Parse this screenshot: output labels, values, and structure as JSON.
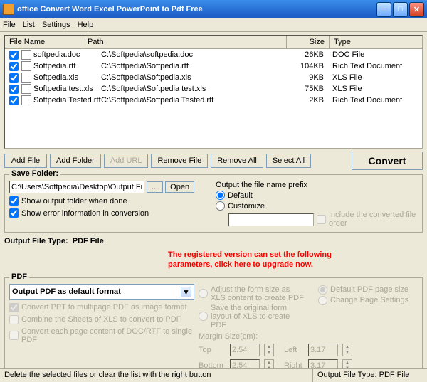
{
  "window": {
    "title": "office Convert Word Excel PowerPoint to Pdf Free"
  },
  "menu": [
    "File",
    "List",
    "Settings",
    "Help"
  ],
  "columns": {
    "name": "File Name",
    "path": "Path",
    "size": "Size",
    "type": "Type"
  },
  "files": [
    {
      "name": "softpedia.doc",
      "path": "C:\\Softpedia\\softpedia.doc",
      "size": "26KB",
      "type": "DOC File"
    },
    {
      "name": "Softpedia.rtf",
      "path": "C:\\Softpedia\\Softpedia.rtf",
      "size": "104KB",
      "type": "Rich Text Document"
    },
    {
      "name": "Softpedia.xls",
      "path": "C:\\Softpedia\\Softpedia.xls",
      "size": "9KB",
      "type": "XLS File"
    },
    {
      "name": "Softpedia test.xls",
      "path": "C:\\Softpedia\\Softpedia test.xls",
      "size": "75KB",
      "type": "XLS File"
    },
    {
      "name": "Softpedia Tested.rtf",
      "path": "C:\\Softpedia\\Softpedia Tested.rtf",
      "size": "2KB",
      "type": "Rich Text Document"
    }
  ],
  "buttons": {
    "addFile": "Add File",
    "addFolder": "Add Folder",
    "addURL": "Add URL",
    "removeFile": "Remove File",
    "removeAll": "Remove All",
    "selectAll": "Select All",
    "convert": "Convert"
  },
  "save": {
    "legend": "Save Folder:",
    "path": "C:\\Users\\Softpedia\\Desktop\\Output Files",
    "browse": "...",
    "open": "Open",
    "showFolder": "Show output folder when done",
    "showError": "Show error information in conversion",
    "prefixLabel": "Output the file name prefix",
    "default": "Default",
    "customize": "Customize",
    "includeOrder": "Include the converted file order"
  },
  "outputType": {
    "label": "Output File Type:",
    "value": "PDF File"
  },
  "redNotice1": "The registered version can set the following",
  "redNotice2": "parameters, click here to upgrade now.",
  "pdf": {
    "legend": "PDF",
    "dropdown": "Output PDF as default format",
    "convertPPT": "Convert PPT to multipage PDF as image format",
    "combineSheets": "Combine the Sheets of XLS to convert to PDF",
    "convertEach": "Convert each page content of DOC/RTF to single PDF",
    "adjustForm": "Adjust the form size as XLS content to create PDF",
    "saveOriginal": "Save the original form layout of XLS to create PDF",
    "defaultPage": "Default PDF page size",
    "changePage": "Change Page Settings",
    "marginLabel": "Margin Size(cm):",
    "top": "Top",
    "topVal": "2.54",
    "left": "Left",
    "leftVal": "3.17",
    "bottom": "Bottom",
    "bottomVal": "2.54",
    "right": "Right",
    "rightVal": "3.17"
  },
  "status": {
    "hint": "Delete the selected files or clear the list with the right button",
    "outputType": "Output File Type:  PDF File"
  }
}
